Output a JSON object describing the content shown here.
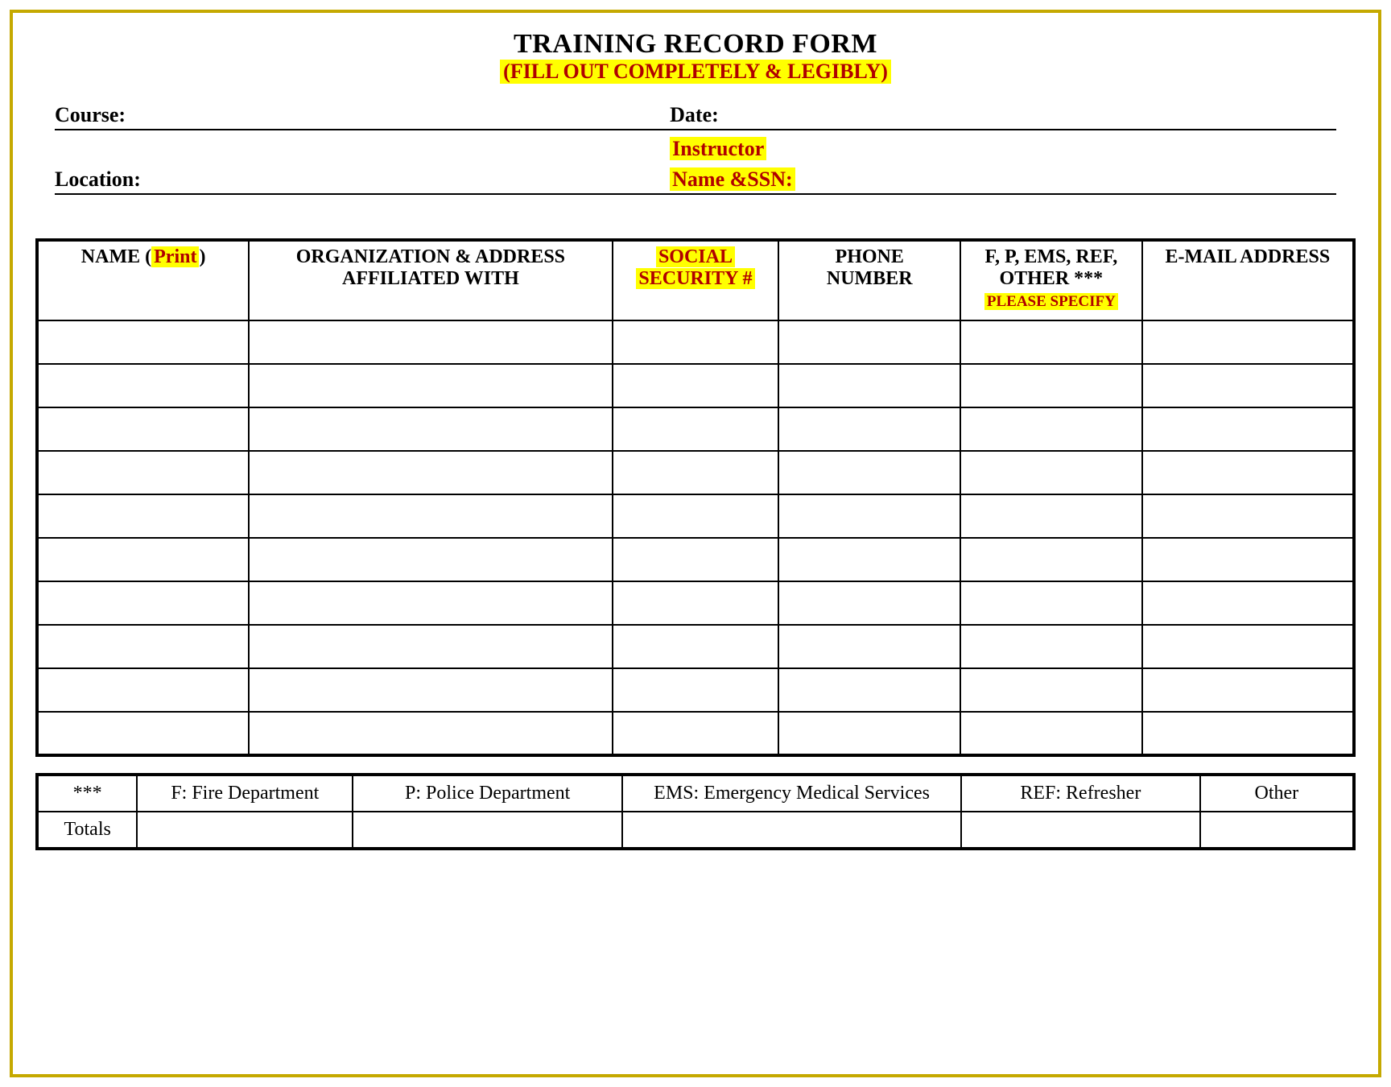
{
  "header": {
    "title": "TRAINING RECORD FORM",
    "subtitle": "(FILL OUT COMPLETELY & LEGIBLY)"
  },
  "meta": {
    "course_label": "Course:",
    "date_label": "Date:",
    "location_label": "Location:",
    "instructor_label_1": "Instructor",
    "instructor_label_2": "Name &SSN:"
  },
  "columns": {
    "name_prefix": "NAME (",
    "name_hl": "Print",
    "name_suffix": ")",
    "org_line1": "ORGANIZATION & ADDRESS",
    "org_line2": "AFFILIATED WITH",
    "ssn_line1": "SOCIAL",
    "ssn_line2": "SECURITY #",
    "phone_line1": "PHONE",
    "phone_line2": "NUMBER",
    "type_line1": "F, P, EMS, REF,",
    "type_line2": "OTHER ***",
    "type_line3": "PLEASE SPECIFY",
    "email": "E-MAIL ADDRESS"
  },
  "legend": {
    "stars": "***",
    "f": "F: Fire Department",
    "p": "P:   Police Department",
    "ems": "EMS: Emergency Medical Services",
    "ref": "REF:   Refresher",
    "other": "Other",
    "totals": "Totals"
  }
}
